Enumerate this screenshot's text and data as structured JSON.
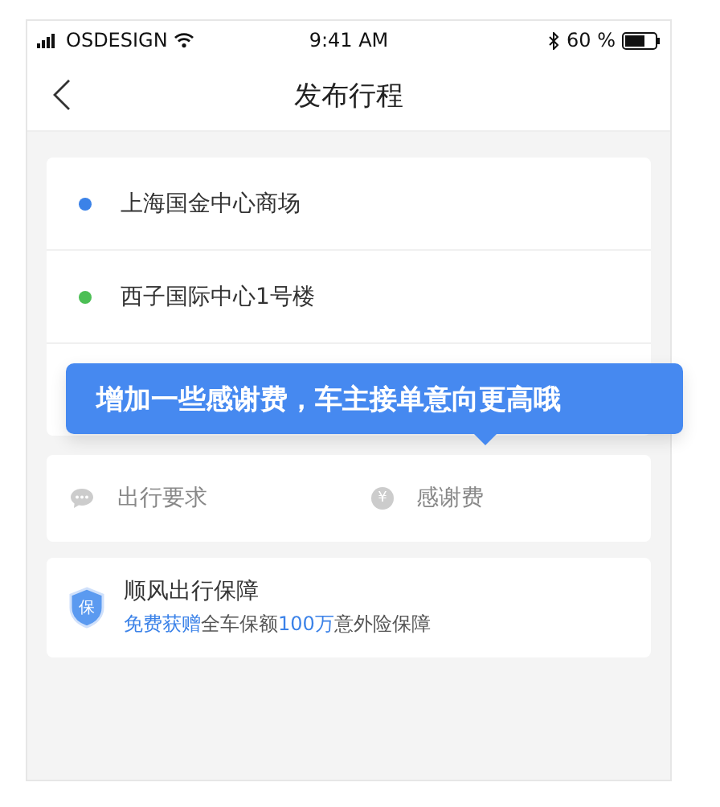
{
  "status_bar": {
    "carrier": "OSDESIGN",
    "time": "9:41 AM",
    "battery": "60 %"
  },
  "nav": {
    "title": "发布行程"
  },
  "route": [
    {
      "label": "上海国金中心商场",
      "color": "#3b82e8"
    },
    {
      "label": "西子国际中心1号楼",
      "color": "#4cbf55"
    }
  ],
  "tooltip": "增加一些感谢费，车主接单意向更高哦",
  "options": [
    {
      "kind": "chat",
      "label": "出行要求"
    },
    {
      "kind": "coin",
      "icon_text": "¥",
      "label": "感谢费"
    }
  ],
  "insurance": {
    "icon_text": "保",
    "title": "顺风出行保障",
    "subtitle": [
      {
        "text": "免费获赠",
        "highlight": true
      },
      {
        "text": "全车保额",
        "highlight": false
      },
      {
        "text": "100万",
        "highlight": true
      },
      {
        "text": "意外险保障",
        "highlight": false
      }
    ]
  }
}
